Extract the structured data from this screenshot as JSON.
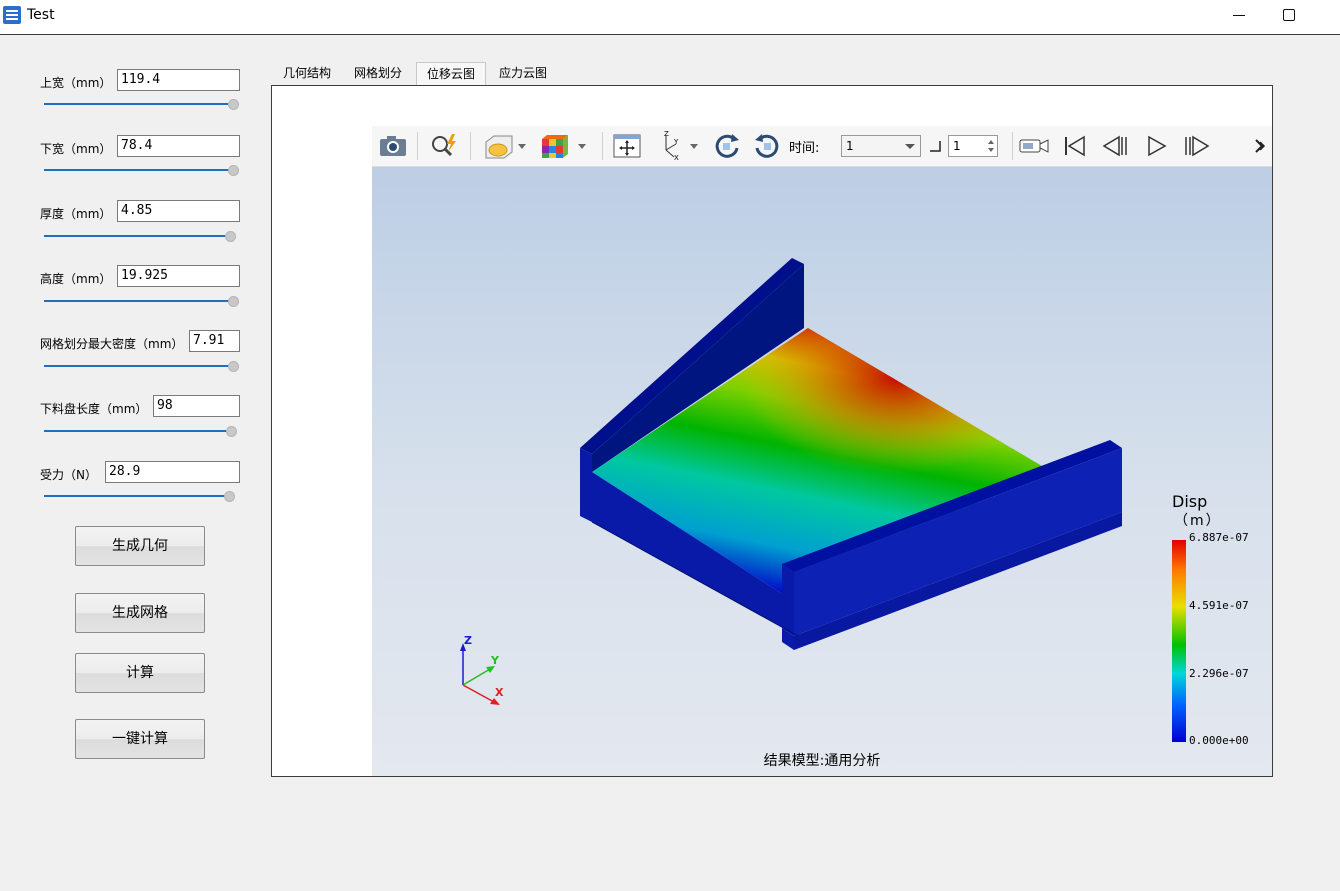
{
  "window": {
    "title": "Test"
  },
  "params": [
    {
      "label": "上宽（mm）",
      "value": "119.4",
      "fill": 0.99
    },
    {
      "label": "下宽（mm）",
      "value": "78.4",
      "fill": 0.99
    },
    {
      "label": "厚度（mm）",
      "value": "4.85",
      "fill": 0.97
    },
    {
      "label": "高度（mm）",
      "value": "19.925",
      "fill": 0.99
    },
    {
      "label": "网格划分最大密度（mm）",
      "value": "7.91",
      "fill": 0.99
    },
    {
      "label": "下料盘长度（mm）",
      "value": "98",
      "fill": 0.97
    },
    {
      "label": "受力（N）",
      "value": "28.9",
      "fill": 0.96
    }
  ],
  "buttons": {
    "gen_geometry": "生成几何",
    "gen_mesh": "生成网格",
    "compute": "计算",
    "one_click": "一键计算"
  },
  "tabs": [
    "几何结构",
    "网格划分",
    "位移云图",
    "应力云图"
  ],
  "active_tab": "位移云图",
  "toolbar": {
    "time_label": "时间:",
    "time_value": "1",
    "step_value": "1"
  },
  "legend": {
    "title": "Disp",
    "unit": "（m）",
    "ticks": [
      "6.887e-07",
      "4.591e-07",
      "2.296e-07",
      "0.000e+00"
    ],
    "colors": [
      "#e00000",
      "#ff7a00",
      "#e8e000",
      "#00c000",
      "#00d8d8",
      "#0060ff",
      "#0000d0"
    ]
  },
  "axes": {
    "x": "X",
    "y": "Y",
    "z": "Z"
  },
  "caption": "结果模型:通用分析",
  "colors": {
    "accent": "#1f6fbf",
    "model_blue": "#0a1aa8"
  }
}
